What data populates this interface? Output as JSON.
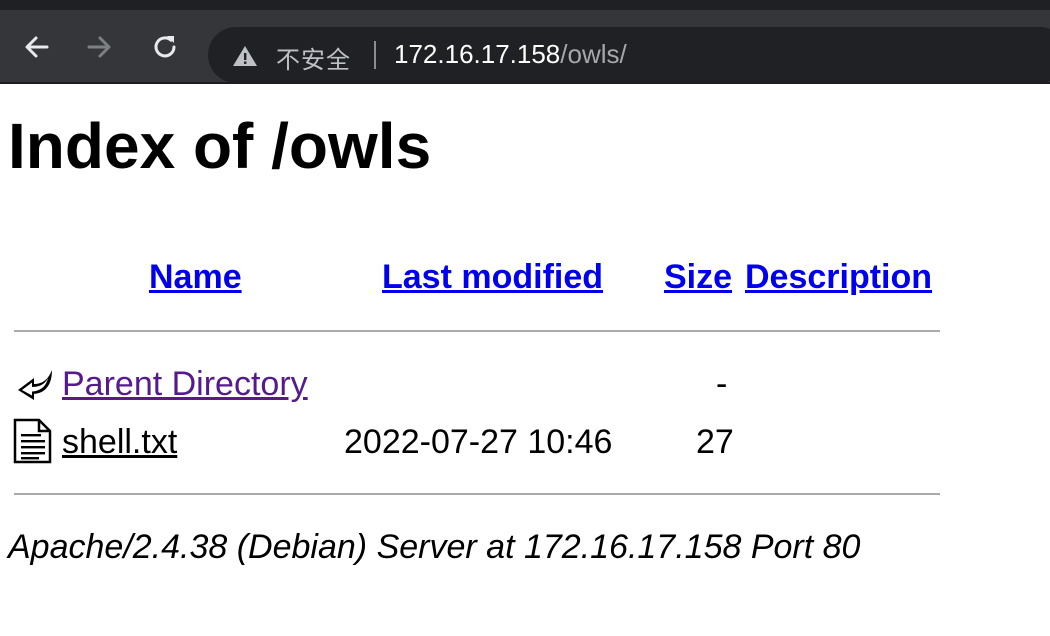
{
  "browser": {
    "security_label": "不安全",
    "url_host": "172.16.17.158",
    "url_path": "/owls/",
    "icons": {
      "back": "arrow-left-icon",
      "forward": "arrow-right-icon",
      "reload": "reload-icon",
      "security": "warning-triangle-icon"
    }
  },
  "page": {
    "title": "Index of /owls",
    "columns": {
      "name": "Name",
      "last_modified": "Last modified",
      "size": "Size",
      "description": "Description"
    },
    "entries": [
      {
        "icon": "back-arrow-icon",
        "name": "Parent Directory",
        "last_modified": "",
        "size": "-",
        "description": "",
        "visited": true
      },
      {
        "icon": "text-file-icon",
        "name": "shell.txt",
        "last_modified": "2022-07-27 10:46",
        "size": "27",
        "description": "",
        "visited": false
      }
    ],
    "footer": "Apache/2.4.38 (Debian) Server at 172.16.17.158 Port 80"
  },
  "colors": {
    "link": "#0000ee",
    "visited_link": "#551a8b",
    "toolbar": "#35363a",
    "omnibox": "#202124"
  }
}
